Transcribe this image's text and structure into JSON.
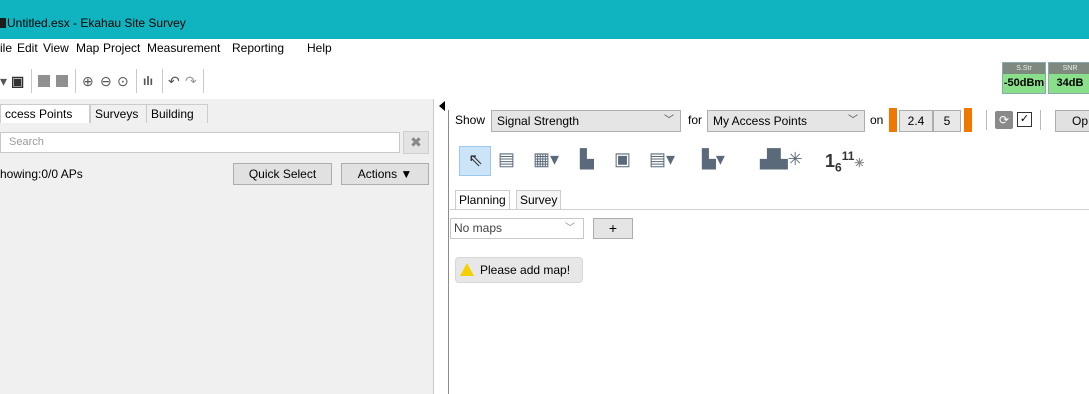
{
  "window": {
    "title": "Untitled.esx - Ekahau Site Survey",
    "accent": "#0fb4c0"
  },
  "menu": [
    "ile",
    "Edit",
    "View",
    "Map",
    "Project",
    "Measurement",
    "Reporting",
    "Help"
  ],
  "status": {
    "sstr_label": "S.Str",
    "sstr_value": "-50dBm",
    "snr_label": "SNR",
    "snr_value": "34dB"
  },
  "left": {
    "tabs": [
      "ccess Points",
      "Surveys",
      "Building"
    ],
    "search_placeholder": "Search",
    "showing": "howing:0/0 APs",
    "quick_select": "Quick Select",
    "actions": "Actions ▼"
  },
  "right": {
    "show_label": "Show",
    "show_value": "Signal Strength",
    "for_label": "for",
    "for_value": "My Access Points",
    "on_label": "on",
    "band1": "2.4",
    "band2": "5",
    "options": "Op",
    "channel_label_1": "1",
    "channel_label_6": "6",
    "channel_label_11": "11",
    "subtabs": [
      "Planning",
      "Survey"
    ],
    "maps_value": "No maps",
    "add_label": "+",
    "warning": "Please add map!"
  }
}
